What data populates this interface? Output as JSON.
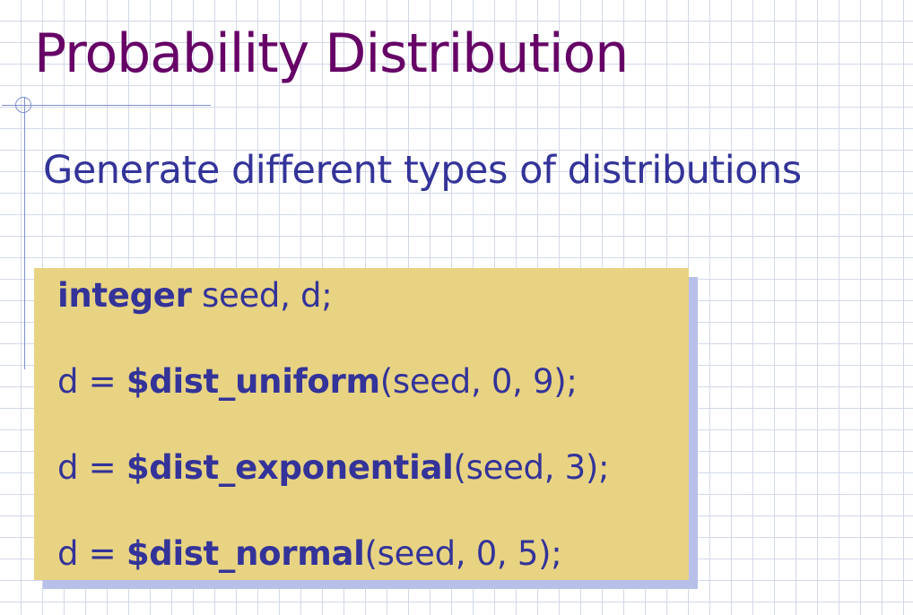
{
  "slide": {
    "title": "Probability Distribution",
    "subtitle": "Generate different types of distributions"
  },
  "code": {
    "line1": {
      "keyword": "integer",
      "rest": " seed, d;"
    },
    "line2": {
      "prefix": "d = ",
      "func": "$dist_uniform",
      "args": "(seed, 0, 9);"
    },
    "line3": {
      "prefix": "d = ",
      "func": "$dist_exponential",
      "args": "(seed, 3);"
    },
    "line4": {
      "prefix": "d = ",
      "func": "$dist_normal",
      "args": "(seed, 0, 5);"
    }
  },
  "colors": {
    "title": "#660066",
    "text": "#333399",
    "code_box": "#e8d383",
    "code_shadow": "#b8bfe8",
    "grid": "#d2d8ea"
  }
}
